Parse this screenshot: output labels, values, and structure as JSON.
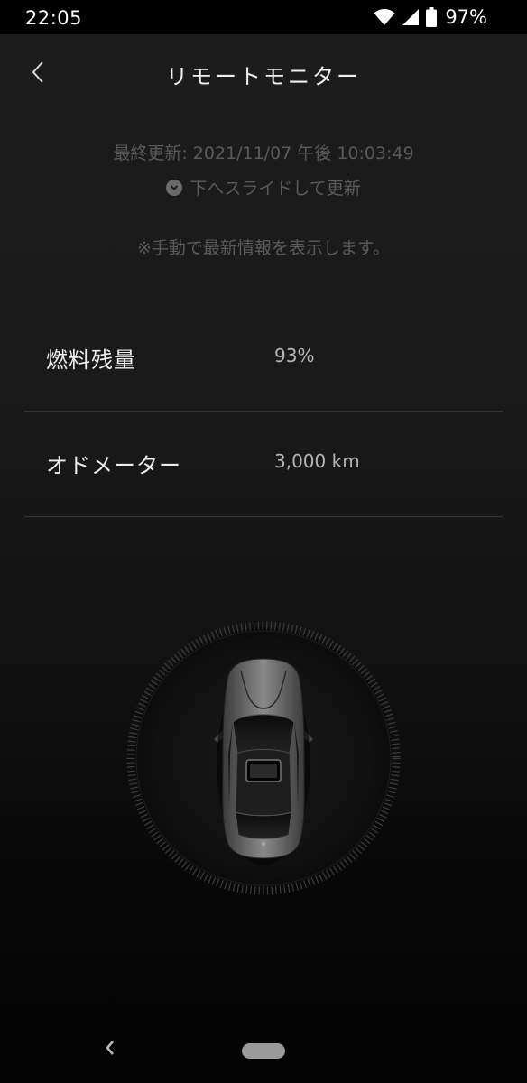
{
  "status_bar": {
    "time": "22:05",
    "battery": "97%",
    "icons": [
      "wifi-icon",
      "cellular-signal-icon",
      "battery-icon"
    ]
  },
  "header": {
    "title": "リモートモニター",
    "back_icon": "chevron-left-icon"
  },
  "update": {
    "last_updated": "最終更新: 2021/11/07 午後 10:03:49",
    "slide_hint": "下へスライドして更新",
    "slide_icon": "chevron-down-circle-icon",
    "manual_note": "※手動で最新情報を表示します。"
  },
  "info": {
    "fuel": {
      "label": "燃料残量",
      "value": "93%"
    },
    "odometer": {
      "label": "オドメーター",
      "value": "3,000 km"
    }
  },
  "car": {
    "image": "car-top-view"
  },
  "nav_bar": {
    "back_icon": "nav-back-icon",
    "home_icon": "home-pill"
  },
  "colors": {
    "background_top": "#1c1c1c",
    "background_bottom": "#030303",
    "text_primary": "#ececec",
    "text_muted": "#5a5a5a",
    "divider": "#353535"
  }
}
